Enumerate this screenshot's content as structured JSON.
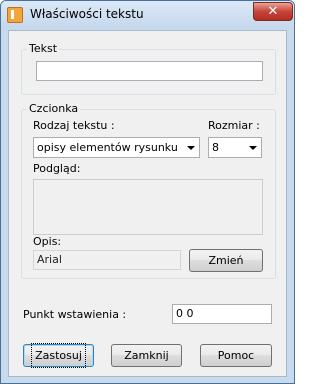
{
  "window": {
    "title": "Właściwości tekstu",
    "close_label": "✕"
  },
  "tekst_group": {
    "legend": "Tekst",
    "value": ""
  },
  "font_group": {
    "legend": "Czcionka",
    "type_label": "Rodzaj tekstu :",
    "type_value": "opisy elementów rysunku",
    "size_label": "Rozmiar :",
    "size_value": "8",
    "preview_label": "Podgląd:",
    "desc_label": "Opis:",
    "desc_value": "Arial",
    "change_label": "Zmień"
  },
  "insertion": {
    "label": "Punkt wstawienia :",
    "value": "0 0"
  },
  "buttons": {
    "apply": "Zastosuj",
    "close": "Zamknij",
    "help": "Pomoc"
  }
}
